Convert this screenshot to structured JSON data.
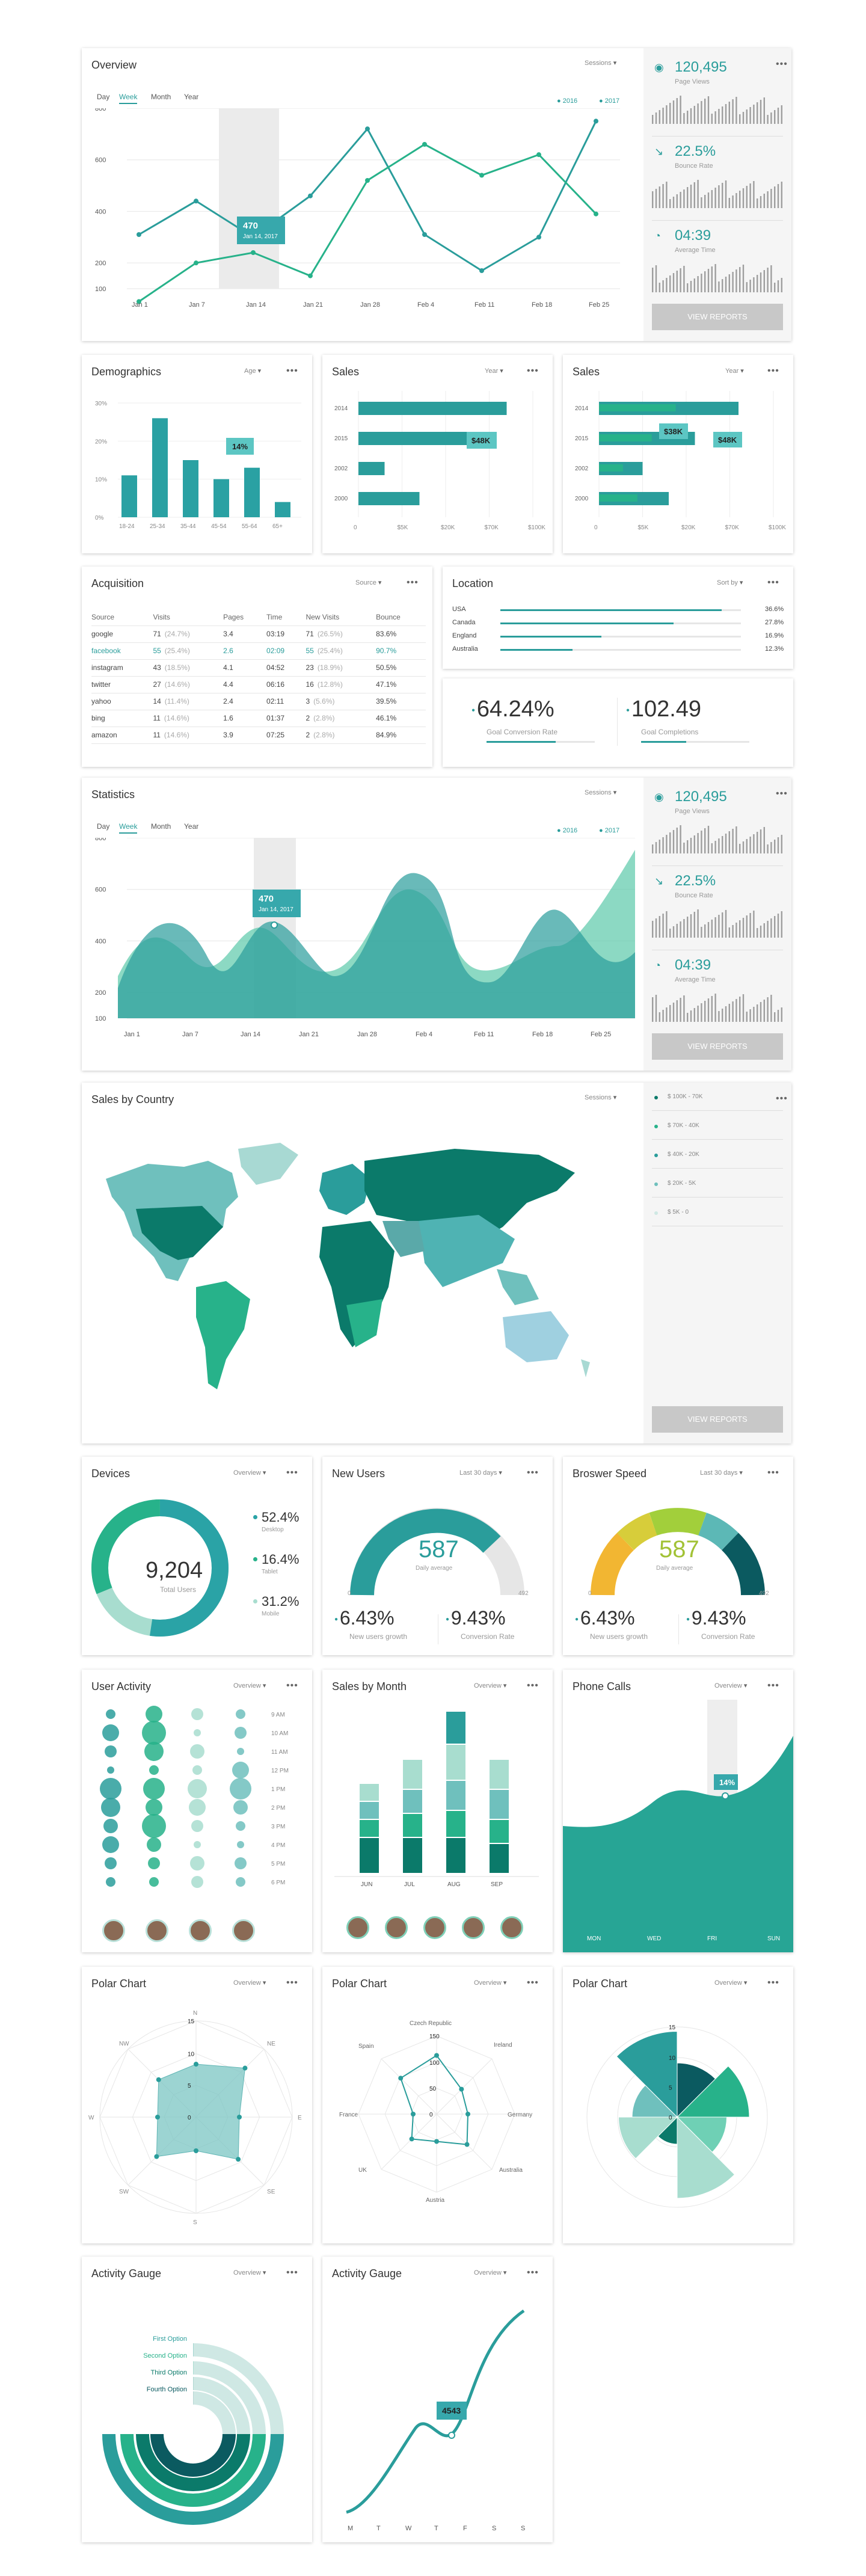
{
  "colors": {
    "teal": "#2a9d9b",
    "green": "#27b28a",
    "dark": "#0b5a60",
    "light": "#a8d9d3"
  },
  "overview": {
    "title": "Overview",
    "select": "Sessions",
    "tabs": [
      "Day",
      "Week",
      "Month",
      "Year"
    ],
    "legend": [
      "2016",
      "2017"
    ],
    "yticks": [
      "800",
      "600",
      "400",
      "200",
      "100"
    ],
    "xticks": [
      "Jan 1",
      "Jan 7",
      "Jan 14",
      "Jan 21",
      "Jan 28",
      "Feb 4",
      "Feb 11",
      "Feb 18",
      "Feb 25"
    ],
    "tooltip_value": "470",
    "tooltip_date": "Jan 14, 2017"
  },
  "chart_data": [
    {
      "type": "line",
      "title": "Overview",
      "categories": [
        "Jan 1",
        "Jan 7",
        "Jan 14",
        "Jan 21",
        "Jan 28",
        "Feb 4",
        "Feb 11",
        "Feb 18",
        "Feb 25"
      ],
      "series": [
        {
          "name": "2016",
          "values": [
            310,
            440,
            300,
            460,
            720,
            310,
            170,
            300,
            750
          ]
        },
        {
          "name": "2017",
          "values": [
            50,
            200,
            240,
            150,
            520,
            660,
            540,
            620,
            390
          ]
        }
      ],
      "ylim": [
        100,
        800
      ]
    },
    {
      "type": "bar",
      "title": "Demographics",
      "categories": [
        "18-24",
        "25-34",
        "35-44",
        "45-54",
        "55-64",
        "65+"
      ],
      "values": [
        11,
        26,
        15,
        10,
        13,
        4
      ],
      "ylim": [
        0,
        30
      ]
    },
    {
      "type": "bar",
      "title": "Sales",
      "categories": [
        "2014",
        "2015",
        "2002",
        "2000"
      ],
      "values": [
        85,
        75,
        15,
        35
      ]
    },
    {
      "type": "bar",
      "title": "Sales",
      "categories": [
        "2014",
        "2015",
        "2002",
        "2000"
      ],
      "values": [
        80,
        55,
        25,
        40
      ]
    }
  ],
  "stats_side": [
    {
      "value": "120,495",
      "label": "Page Views"
    },
    {
      "value": "22.5%",
      "label": "Bounce Rate"
    },
    {
      "value": "04:39",
      "label": "Average Time"
    }
  ],
  "view_reports": "VIEW REPORTS",
  "demographics": {
    "title": "Demographics",
    "select": "Age",
    "yticks": [
      "30%",
      "20%",
      "10%",
      "0%"
    ],
    "xticks": [
      "18-24",
      "25-34",
      "35-44",
      "45-54",
      "55-64",
      "65+"
    ],
    "tooltip": "14%"
  },
  "sales1": {
    "title": "Sales",
    "select": "Year",
    "years": [
      "2014",
      "2015",
      "2002",
      "2000"
    ],
    "xticks": [
      "0",
      "$5K",
      "$20K",
      "$70K",
      "$100K"
    ],
    "tooltip": "$48K"
  },
  "sales2": {
    "title": "Sales",
    "select": "Year",
    "years": [
      "2014",
      "2015",
      "2002",
      "2000"
    ],
    "xticks": [
      "0",
      "$5K",
      "$20K",
      "$70K",
      "$100K"
    ],
    "tooltip1": "$38K",
    "tooltip2": "$48K"
  },
  "acquisition": {
    "title": "Acquisition",
    "select": "Source",
    "headers": [
      "Source",
      "Visits",
      "Pages",
      "Time",
      "New Visits",
      "Bounce"
    ],
    "rows": [
      [
        "google",
        "71",
        "(24.7%)",
        "3.4",
        "03:19",
        "71",
        "(26.5%)",
        "83.6%"
      ],
      [
        "facebook",
        "55",
        "(25.4%)",
        "2.6",
        "02:09",
        "55",
        "(25.4%)",
        "90.7%"
      ],
      [
        "instagram",
        "43",
        "(18.5%)",
        "4.1",
        "04:52",
        "23",
        "(18.9%)",
        "50.5%"
      ],
      [
        "twitter",
        "27",
        "(14.6%)",
        "4.4",
        "06:16",
        "16",
        "(12.8%)",
        "47.1%"
      ],
      [
        "yahoo",
        "14",
        "(11.4%)",
        "2.4",
        "02:11",
        "3",
        "(5.6%)",
        "39.5%"
      ],
      [
        "bing",
        "11",
        "(14.6%)",
        "1.6",
        "01:37",
        "2",
        "(2.8%)",
        "46.1%"
      ],
      [
        "amazon",
        "11",
        "(14.6%)",
        "3.9",
        "07:25",
        "2",
        "(2.8%)",
        "84.9%"
      ]
    ]
  },
  "location": {
    "title": "Location",
    "select": "Sort by",
    "rows": [
      {
        "name": "USA",
        "pct": "36.6%",
        "v": 0.92
      },
      {
        "name": "Canada",
        "pct": "27.8%",
        "v": 0.72
      },
      {
        "name": "England",
        "pct": "16.9%",
        "v": 0.42
      },
      {
        "name": "Australia",
        "pct": "12.3%",
        "v": 0.3
      }
    ]
  },
  "goals": {
    "conv": "64.24%",
    "conv_label": "Goal Conversion Rate",
    "comp": "102.49",
    "comp_label": "Goal Completions"
  },
  "statistics": {
    "title": "Statistics",
    "select": "Sessions"
  },
  "country": {
    "title": "Sales by Country",
    "select": "Sessions",
    "legend": [
      "$ 100K - 70K",
      "$ 70K - 40K",
      "$ 40K - 20K",
      "$ 20K - 5K",
      "$ 5K - 0"
    ]
  },
  "devices": {
    "title": "Devices",
    "select": "Overview",
    "total": "9,204",
    "total_label": "Total Users",
    "items": [
      {
        "pct": "52.4%",
        "label": "Desktop"
      },
      {
        "pct": "16.4%",
        "label": "Tablet"
      },
      {
        "pct": "31.2%",
        "label": "Mobile"
      }
    ]
  },
  "newusers": {
    "title": "New Users",
    "select": "Last 30 days",
    "value": "587",
    "sub": "Daily average",
    "min": "0",
    "max": "492",
    "p1": "6.43%",
    "l1": "New users growth",
    "p2": "9.43%",
    "l2": "Conversion Rate"
  },
  "browser": {
    "title": "Broswer Speed",
    "select": "Last 30 days",
    "value": "587",
    "sub": "Daily average",
    "min": "0",
    "max": "492",
    "p1": "6.43%",
    "l1": "New users growth",
    "p2": "9.43%",
    "l2": "Conversion Rate"
  },
  "useractivity": {
    "title": "User Activity",
    "select": "Overview",
    "times": [
      "9 AM",
      "10 AM",
      "11 AM",
      "12 PM",
      "1 PM",
      "2 PM",
      "3 PM",
      "4 PM",
      "5 PM",
      "6 PM"
    ]
  },
  "salesmonth": {
    "title": "Sales by Month",
    "select": "Overview",
    "months": [
      "JUN",
      "JUL",
      "AUG",
      "SEP"
    ]
  },
  "phone": {
    "title": "Phone Calls",
    "select": "Overview",
    "tooltip": "14%",
    "days": [
      "MON",
      "WED",
      "FRI",
      "SUN"
    ]
  },
  "polar1": {
    "title": "Polar Chart",
    "select": "Overview",
    "dirs": [
      "N",
      "NE",
      "E",
      "SE",
      "S",
      "SW",
      "W",
      "NW"
    ],
    "ticks": [
      "15",
      "10",
      "5",
      "0"
    ]
  },
  "polar2": {
    "title": "Polar Chart",
    "select": "Overview",
    "labels": [
      "Czech Republic",
      "Ireland",
      "Germany",
      "Australia",
      "Austria",
      "UK",
      "France",
      "Spain"
    ],
    "ticks": [
      "150",
      "100",
      "50",
      "0"
    ]
  },
  "polar3": {
    "title": "Polar Chart",
    "select": "Overview",
    "ticks": [
      "15",
      "10",
      "5",
      "0"
    ]
  },
  "gauge1": {
    "title": "Activity Gauge",
    "select": "Overview",
    "options": [
      "First Option",
      "Second Option",
      "Third Option",
      "Fourth Option"
    ]
  },
  "gauge2": {
    "title": "Activity Gauge",
    "select": "Overview",
    "tooltip": "4543",
    "days": [
      "M",
      "T",
      "W",
      "T",
      "F",
      "S",
      "S"
    ]
  }
}
